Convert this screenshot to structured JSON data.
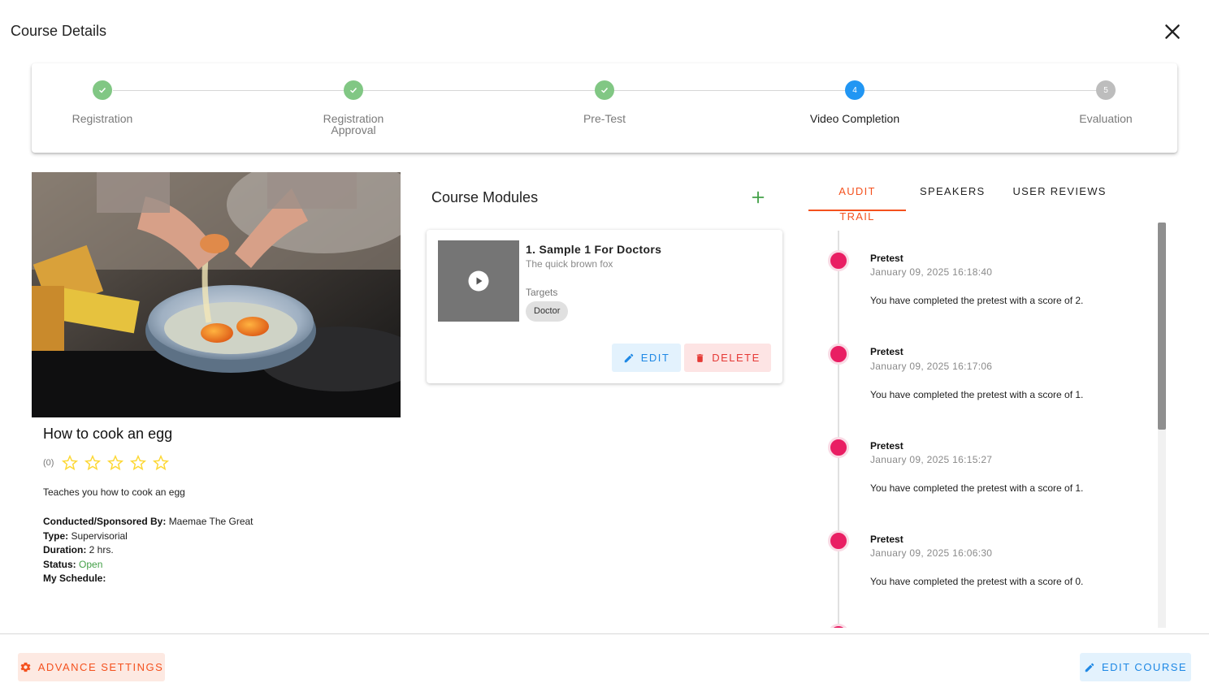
{
  "dialog": {
    "title": "Course Details"
  },
  "stepper": {
    "steps": [
      {
        "number": "1",
        "label": "Registration",
        "state": "done"
      },
      {
        "number": "2",
        "label": "Registration Approval",
        "state": "done"
      },
      {
        "number": "3",
        "label": "Pre-Test",
        "state": "done"
      },
      {
        "number": "4",
        "label": "Video Completion",
        "state": "active"
      },
      {
        "number": "5",
        "label": "Evaluation",
        "state": "pending"
      }
    ]
  },
  "course": {
    "title": "How to cook an egg",
    "rating_count": "(0)",
    "rating": 0,
    "max_rating": 5,
    "description": "Teaches you how to cook an egg",
    "conducted_label": "Conducted/Sponsored By:",
    "conducted_value": "Maemae The Great",
    "type_label": "Type:",
    "type_value": "Supervisorial",
    "duration_label": "Duration:",
    "duration_value": "2 hrs.",
    "status_label": "Status:",
    "status_value": "Open",
    "schedule_label": "My Schedule:",
    "schedule_value": ""
  },
  "modules": {
    "title": "Course Modules",
    "items": [
      {
        "name": "1. Sample 1 For Doctors",
        "subtitle": "The quick brown fox",
        "targets_label": "Targets",
        "targets": [
          "Doctor"
        ],
        "edit_label": "EDIT",
        "delete_label": "DELETE"
      }
    ]
  },
  "tabs": {
    "items": [
      "AUDIT TRAIL",
      "SPEAKERS",
      "USER REVIEWS"
    ],
    "active": "AUDIT TRAIL"
  },
  "audit_trail": [
    {
      "title": "Pretest",
      "date": "January 09, 2025 16:18:40",
      "text": "You have completed the pretest with a score of 2."
    },
    {
      "title": "Pretest",
      "date": "January 09, 2025 16:17:06",
      "text": "You have completed the pretest with a score of 1."
    },
    {
      "title": "Pretest",
      "date": "January 09, 2025 16:15:27",
      "text": "You have completed the pretest with a score of 1."
    },
    {
      "title": "Pretest",
      "date": "January 09, 2025 16:06:30",
      "text": "You have completed the pretest with a score of 0."
    }
  ],
  "footer": {
    "advance_label": "ADVANCE SETTINGS",
    "edit_course_label": "EDIT COURSE"
  },
  "colors": {
    "accent_orange": "#f4511e",
    "accent_blue": "#1e88e5",
    "success_green": "#81c784",
    "timeline_pink": "#e91e63",
    "star_yellow": "#fdd835"
  }
}
